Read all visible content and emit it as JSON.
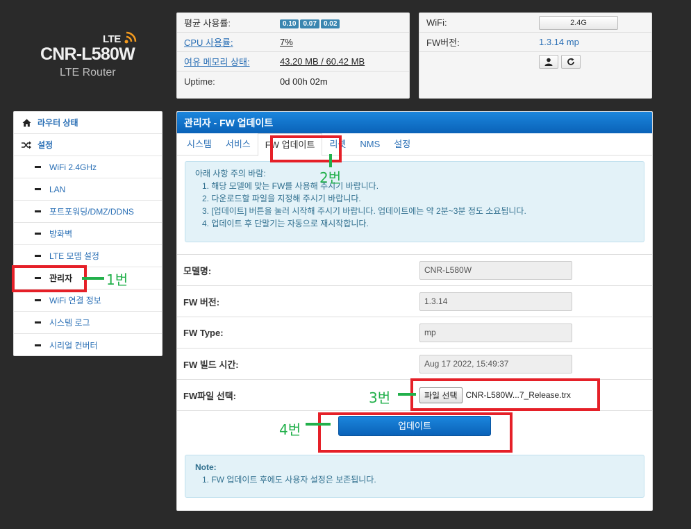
{
  "logo": {
    "lte": "LTE",
    "model": "CNR-L580W",
    "sub": "LTE Router"
  },
  "status": {
    "avg_label": "평균 사용률:",
    "avg_values": [
      "0.10",
      "0.07",
      "0.02"
    ],
    "cpu_label": "CPU 사용률:",
    "cpu_value": "7%",
    "mem_label": "여유 메모리 상태:",
    "mem_value": "43.20 MB / 60.42 MB",
    "uptime_label": "Uptime:",
    "uptime_value": "0d 00h 02m"
  },
  "device": {
    "wifi_label": "WiFi:",
    "wifi_value": "2.4G",
    "fw_label": "FW버전:",
    "fw_value": "1.3.14 mp"
  },
  "sidebar": {
    "items": [
      {
        "label": "라우터 상태",
        "icon": "home-icon"
      },
      {
        "label": "설정",
        "icon": "shuffle-icon"
      },
      {
        "label": "WiFi 2.4GHz"
      },
      {
        "label": "LAN"
      },
      {
        "label": "포트포워딩/DMZ/DDNS"
      },
      {
        "label": "방화벽"
      },
      {
        "label": "LTE 모뎀 설정"
      },
      {
        "label": "관리자"
      },
      {
        "label": "WiFi 연결 정보"
      },
      {
        "label": "시스템 로그"
      },
      {
        "label": "시리얼 컨버터"
      }
    ]
  },
  "main": {
    "title": "관리자 - FW 업데이트",
    "tabs": [
      "시스템",
      "서비스",
      "FW 업데이트",
      "리셋",
      "NMS",
      "설정"
    ],
    "notice": {
      "head": "아래 사항 주의 바람:",
      "items": [
        "1. 해당 모델에 맞는 FW를 사용해 주시기 바랍니다.",
        "2. 다운로드할 파일을 지정해 주시기 바랍니다.",
        "3. [업데이트] 버튼을 눌러 시작해 주시기 바랍니다. 업데이트에는 약 2분~3분 정도 소요됩니다.",
        "4. 업데이트 후 단말기는 자동으로 재시작합니다."
      ]
    },
    "form": {
      "model_label": "모델명:",
      "model_value": "CNR-L580W",
      "fwver_label": "FW 버전:",
      "fwver_value": "1.3.14",
      "fwtype_label": "FW Type:",
      "fwtype_value": "mp",
      "build_label": "FW 빌드 시간:",
      "build_value": "Aug 17 2022, 15:49:37",
      "file_label": "FW파일 선택:",
      "file_button": "파일 선택",
      "file_name": "CNR-L580W...7_Release.trx"
    },
    "update_button": "업데이트",
    "note": {
      "head": "Note:",
      "item": "1. FW 업데이트 후에도 사용자 설정은 보존됩니다."
    }
  },
  "annotations": {
    "a1": "1번",
    "a2": "2번",
    "a3": "3번",
    "a4": "4번"
  },
  "colors": {
    "accent": "#0a62b8",
    "annotation_red": "#e52028",
    "annotation_green": "#22b04b"
  }
}
